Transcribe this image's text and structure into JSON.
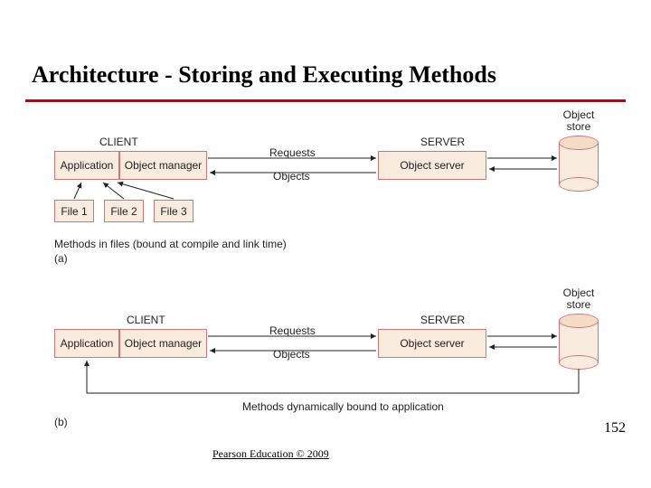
{
  "title": "Architecture - Storing and Executing Methods",
  "footer": "Pearson Education © 2009",
  "page_number": "152",
  "diagram": {
    "a": {
      "client_label": "CLIENT",
      "server_label": "SERVER",
      "application": "Application",
      "object_manager": "Object manager",
      "object_server": "Object server",
      "object_store": "Object store",
      "requests": "Requests",
      "objects": "Objects",
      "files": [
        "File 1",
        "File 2",
        "File 3"
      ],
      "caption": "Methods in files (bound at compile and link time)",
      "tag": "(a)"
    },
    "b": {
      "client_label": "CLIENT",
      "server_label": "SERVER",
      "application": "Application",
      "object_manager": "Object manager",
      "object_server": "Object server",
      "object_store": "Object store",
      "requests": "Requests",
      "objects": "Objects",
      "caption": "Methods dynamically bound to application",
      "tag": "(b)"
    }
  }
}
